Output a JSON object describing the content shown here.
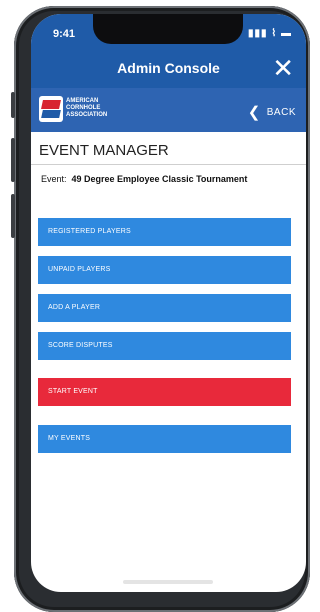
{
  "status": {
    "time": "9:41",
    "icons": "▮▮▮ ⌇ ▬"
  },
  "header": {
    "title": "Admin Console",
    "close_icon": "close-icon"
  },
  "subbar": {
    "logo_lines": [
      "AMERICAN",
      "CORNHOLE",
      "ASSOCIATION"
    ],
    "back_label": "BACK"
  },
  "page": {
    "heading": "EVENT MANAGER",
    "event_label": "Event:",
    "event_name": "49 Degree Employee Classic Tournament"
  },
  "menu": [
    {
      "label": "REGISTERED PLAYERS"
    },
    {
      "label": "UNPAID PLAYERS"
    },
    {
      "label": "ADD A PLAYER"
    },
    {
      "label": "SCORE DISPUTES"
    },
    {
      "label": "START EVENT"
    },
    {
      "label": "MY EVENTS"
    }
  ],
  "colors": {
    "primary": "#1f5ba8",
    "button": "#2f89df",
    "danger": "#e8293b"
  }
}
